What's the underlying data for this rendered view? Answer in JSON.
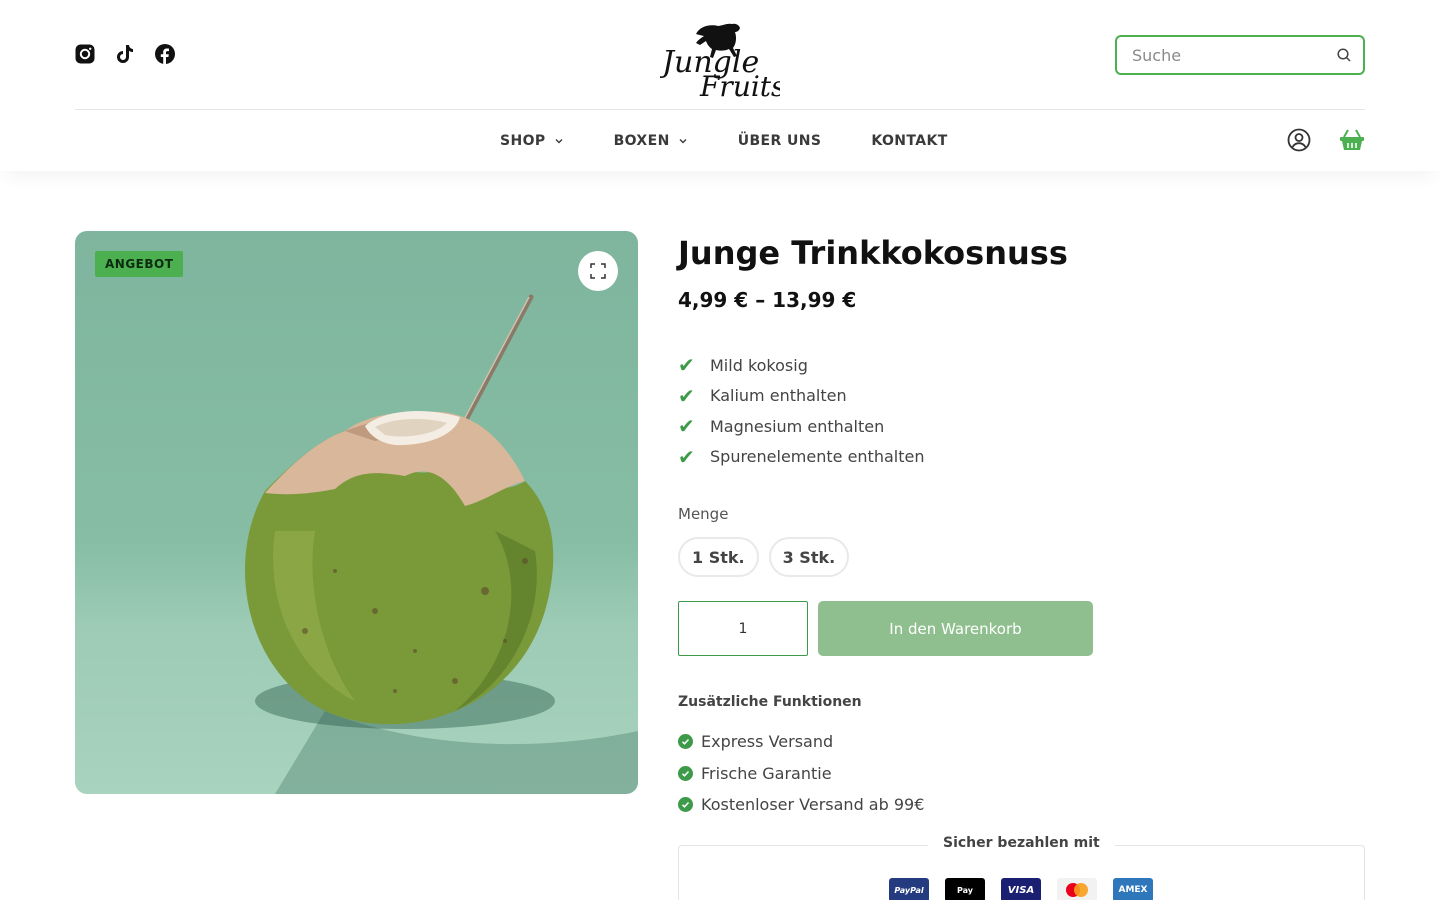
{
  "header": {
    "socials": [
      {
        "icon": "instagram-icon"
      },
      {
        "icon": "tiktok-icon"
      },
      {
        "icon": "facebook-icon"
      }
    ],
    "logo": {
      "line1": "Jungle",
      "line2": "Fruits"
    },
    "search": {
      "placeholder": "Suche",
      "icon": "search-icon"
    }
  },
  "nav": {
    "items": [
      {
        "label": "SHOP",
        "has_dropdown": true
      },
      {
        "label": "BOXEN",
        "has_dropdown": true
      },
      {
        "label": "ÜBER UNS",
        "has_dropdown": false
      },
      {
        "label": "KONTAKT",
        "has_dropdown": false
      }
    ],
    "account_icon": "user-icon",
    "cart_icon": "basket-icon"
  },
  "product": {
    "badge": "ANGEBOT",
    "title": "Junge Trinkkokosnuss",
    "price": "4,99 € – 13,99 €",
    "features": [
      "Mild kokosig",
      "Kalium enthalten",
      "Magnesium enthalten",
      "Spurenelemente enthalten"
    ],
    "quantity_label": "Menge",
    "variants": [
      "1 Stk.",
      "3 Stk."
    ],
    "qty_value": "1",
    "qty_minus": "",
    "qty_plus": "",
    "add_to_cart": "In den Warenkorb",
    "extra_title": "Zusätzliche Funktionen",
    "extras": [
      "Express Versand",
      "Frische Garantie",
      "Kostenloser Versand ab 99€"
    ],
    "payment_title": "Sicher bezahlen mit",
    "payment_methods": [
      {
        "label": "PayPal",
        "bg": "#253b80",
        "fg": "#ffffff"
      },
      {
        "label": "Pay",
        "bg": "#000000",
        "fg": "#ffffff"
      },
      {
        "label": "VISA",
        "bg": "#1a1f71",
        "fg": "#ffffff"
      },
      {
        "label": "",
        "bg": "#f2f2f2",
        "fg": "#000000"
      },
      {
        "label": "AMEX",
        "bg": "#2e77bb",
        "fg": "#ffffff"
      }
    ]
  },
  "colors": {
    "accent": "#4caf50",
    "check": "#3d9a49",
    "button": "#8fbf8f"
  }
}
